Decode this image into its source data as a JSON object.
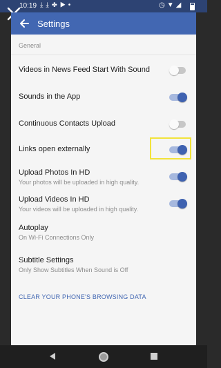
{
  "status_bar": {
    "time": "10:19",
    "left_icons": [
      "download-icon",
      "download-icon",
      "pinwheel-icon",
      "youtube-icon",
      "dot-icon"
    ],
    "right_icons": [
      "alarm-icon",
      "wifi-icon",
      "signal-icon",
      "battery-icon"
    ]
  },
  "header": {
    "title": "Settings"
  },
  "section": {
    "header": "General"
  },
  "settings": [
    {
      "label": "Videos in News Feed Start With Sound",
      "toggle": false
    },
    {
      "label": "Sounds in the App",
      "toggle": true
    },
    {
      "label": "Continuous Contacts Upload",
      "toggle": false
    },
    {
      "label": "Links open externally",
      "toggle": true
    },
    {
      "label": "Upload Photos In HD",
      "sub": "Your photos will be uploaded in high quality.",
      "toggle": true
    },
    {
      "label": "Upload Videos In HD",
      "sub": "Your videos will be uploaded in high quality.",
      "toggle": true
    },
    {
      "label": "Autoplay",
      "sub": "On Wi-Fi Connections Only"
    },
    {
      "label": "Subtitle Settings",
      "sub": "Only Show Subtitles When Sound is Off"
    }
  ],
  "clear_link": "CLEAR YOUR PHONE'S BROWSING DATA",
  "colors": {
    "brand": "#4267b2",
    "status_bar": "#2d4373",
    "toggle_on": "#3f62b0",
    "highlight": "#f2e33a"
  }
}
